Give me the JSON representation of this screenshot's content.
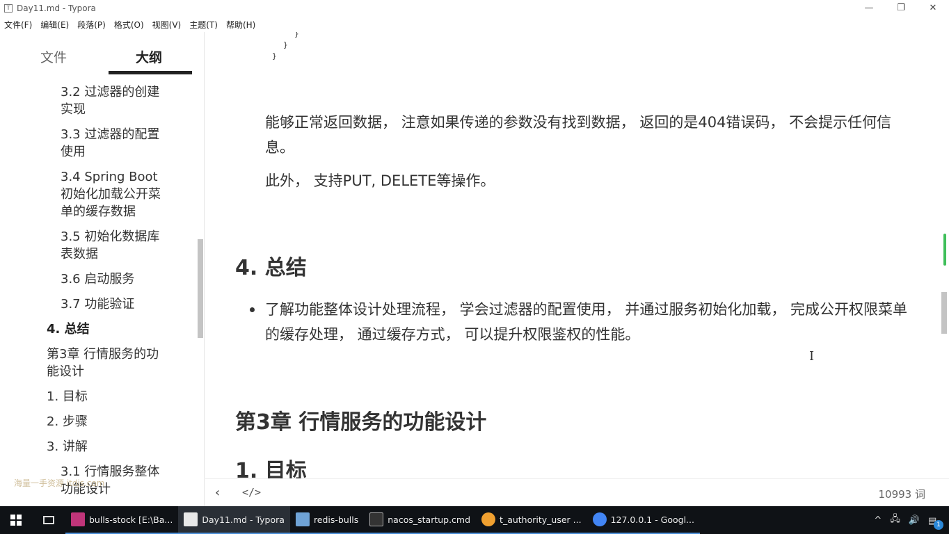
{
  "window": {
    "title": "Day11.md - Typora",
    "icon": "T",
    "controls": [
      "—",
      "❐",
      "✕"
    ]
  },
  "menu": [
    "文件(F)",
    "编辑(E)",
    "段落(P)",
    "格式(O)",
    "视图(V)",
    "主题(T)",
    "帮助(H)"
  ],
  "sidebar": {
    "tabs": {
      "files": "文件",
      "outline": "大纲"
    },
    "items": [
      {
        "text": "3.2 过滤器的创建实现",
        "level": 3
      },
      {
        "text": "3.3 过滤器的配置使用",
        "level": 3
      },
      {
        "text": "3.4 Spring Boot 初始化加载公开菜单的缓存数据",
        "level": 3
      },
      {
        "text": "3.5 初始化数据库表数据",
        "level": 3
      },
      {
        "text": "3.6 启动服务",
        "level": 3
      },
      {
        "text": "3.7 功能验证",
        "level": 3
      },
      {
        "text": "4. 总结",
        "level": 2,
        "active": true
      },
      {
        "text": "第3章 行情服务的功能设计",
        "level": 2
      },
      {
        "text": "1. 目标",
        "level": 2
      },
      {
        "text": "2. 步骤",
        "level": 2
      },
      {
        "text": "3. 讲解",
        "level": 2
      },
      {
        "text": "3.1 行情服务整体功能设计",
        "level": 3
      }
    ],
    "watermark": "海量一手资源 itdjs.com"
  },
  "editor": {
    "code": [
      "}",
      "}",
      "}"
    ],
    "para1": "能够正常返回数据， 注意如果传递的参数没有找到数据， 返回的是404错误码， 不会提示任何信息。",
    "para2": "此外， 支持PUT, DELETE等操作。",
    "heading_summary": "4. 总结",
    "bullet": "了解功能整体设计处理流程， 学会过滤器的配置使用， 并通过服务初始化加载， 完成公开权限菜单的缓存处理， 通过缓存方式， 可以提升权限鉴权的性能。",
    "heading_chapter": "第3章 行情服务的功能设计",
    "heading_goal": "1. 目标"
  },
  "status": {
    "back": "‹",
    "source_toggle": "</>",
    "word_count": "10993 词"
  },
  "taskbar": {
    "tasks": [
      {
        "label": "bulls-stock [E:\\Ba...",
        "color": "#c0357a"
      },
      {
        "label": "Day11.md - Typora",
        "color": "#e8e8e8",
        "active": true
      },
      {
        "label": "redis-bulls",
        "color": "#6fa3d6"
      },
      {
        "label": "nacos_startup.cmd",
        "color": "#333333"
      },
      {
        "label": "t_authority_user ...",
        "color": "#f0a030"
      },
      {
        "label": "127.0.0.1 - Googl...",
        "color": "#4285f4"
      }
    ],
    "tray": [
      "^",
      "🖧",
      "🔊"
    ],
    "notification_count": "1"
  }
}
